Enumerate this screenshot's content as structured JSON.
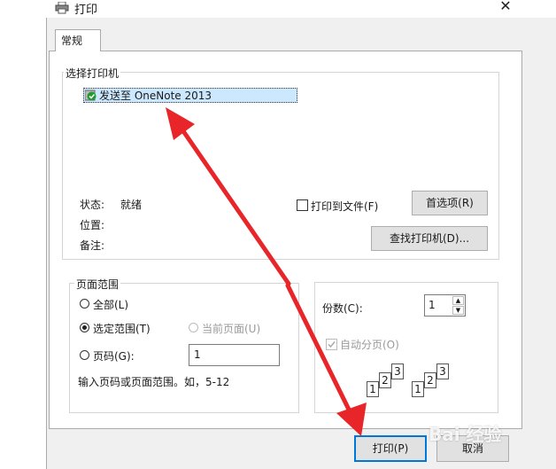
{
  "window": {
    "title": "打印",
    "close_symbol": "✕"
  },
  "tabs": [
    {
      "label": "常规"
    }
  ],
  "printer_group": {
    "legend": "选择打印机",
    "printers": [
      {
        "name": "发送至 OneNote 2013",
        "selected": true
      }
    ],
    "status_label": "状态:",
    "status_value": "就绪",
    "location_label": "位置:",
    "location_value": "",
    "comment_label": "备注:",
    "comment_value": "",
    "print_to_file_label": "打印到文件(F)",
    "preferences_button": "首选项(R)",
    "find_printer_button": "查找打印机(D)..."
  },
  "page_range_group": {
    "legend": "页面范围",
    "all_label": "全部(L)",
    "selection_label": "选定范围(T)",
    "current_page_label": "当前页面(U)",
    "pages_label": "页码(G):",
    "pages_value": "1",
    "hint": "输入页码或页面范围。如，5-12",
    "selected_option": "selection"
  },
  "copies_group": {
    "copies_label": "份数(C):",
    "copies_value": "1",
    "collate_label": "自动分页(O)",
    "collate_checked": true,
    "collate_enabled": false
  },
  "footer": {
    "print_button": "打印(P)",
    "cancel_button": "取消"
  },
  "watermark": {
    "text": "Bai 经验"
  },
  "colors": {
    "accent": "#0078d7",
    "arrow": "#e8262a",
    "selection": "#cce8ff"
  }
}
